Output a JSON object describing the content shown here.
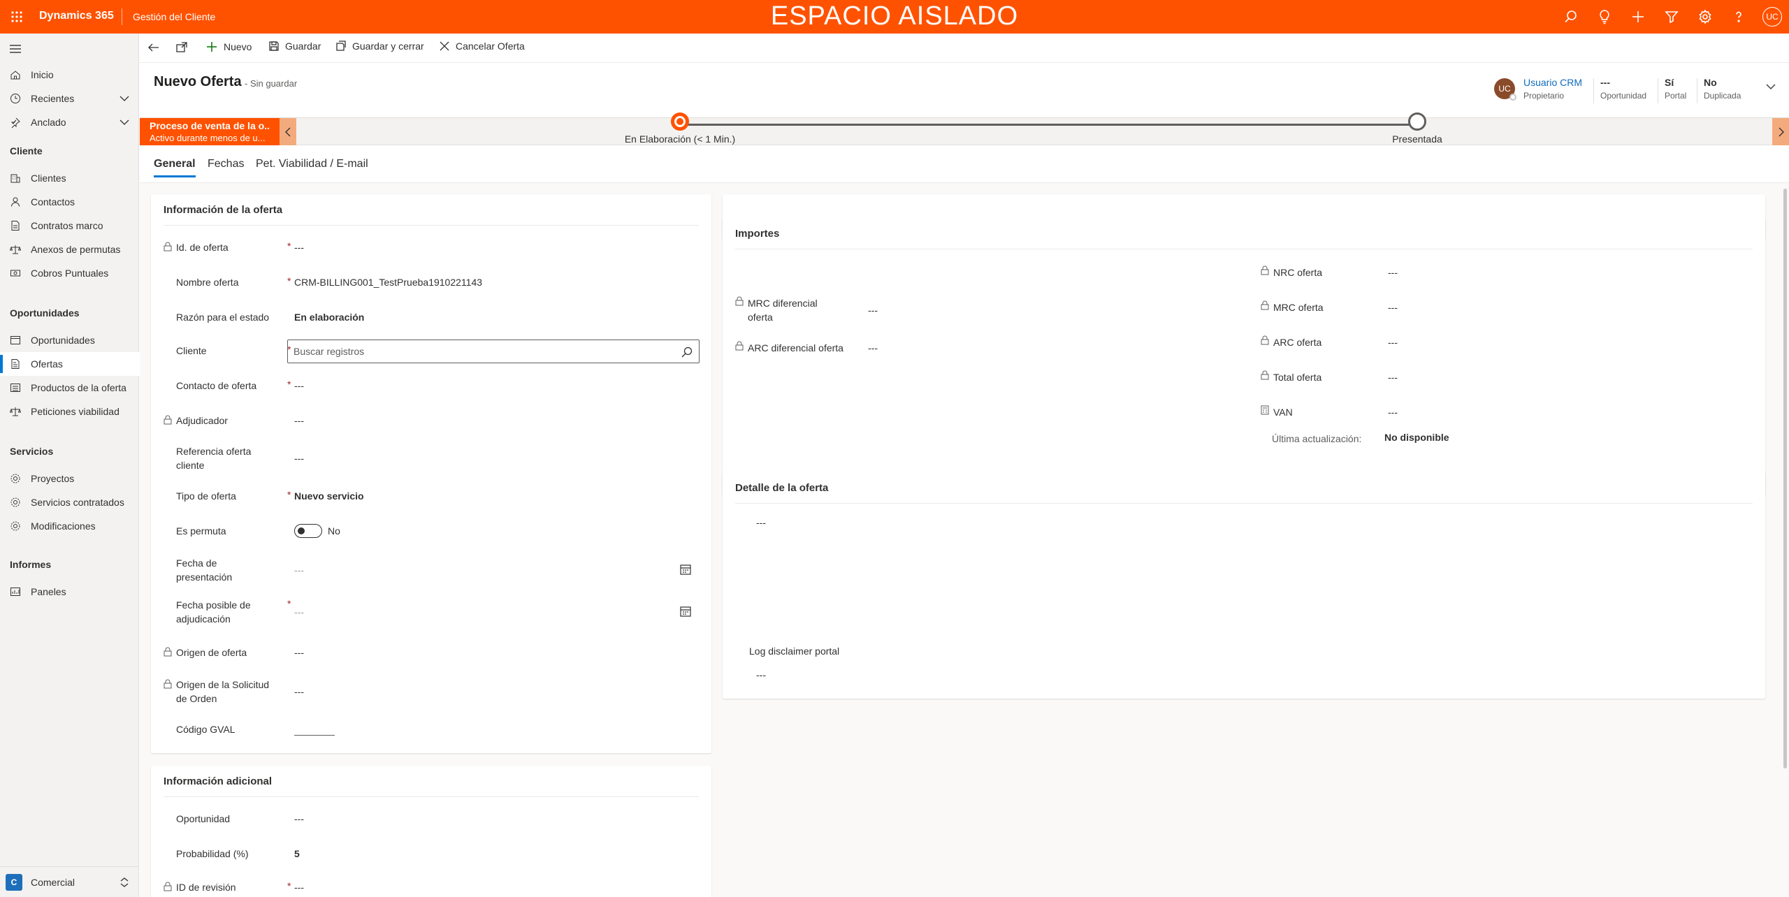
{
  "topbar": {
    "app_name": "Dynamics 365",
    "module": "Gestión del Cliente",
    "banner": "ESPACIO AISLADO",
    "user_initials": "UC",
    "icons": [
      "search-icon",
      "lightbulb-icon",
      "plus-icon",
      "filter-icon",
      "gear-icon",
      "help-icon"
    ]
  },
  "sidebar": {
    "top_items": [
      {
        "label": "Inicio",
        "icon": "home-icon"
      },
      {
        "label": "Recientes",
        "icon": "clock-icon"
      },
      {
        "label": "Anclado",
        "icon": "pin-icon"
      }
    ],
    "groups": [
      {
        "title": "Cliente",
        "items": [
          {
            "label": "Clientes",
            "icon": "building-icon"
          },
          {
            "label": "Contactos",
            "icon": "person-icon"
          },
          {
            "label": "Contratos marco",
            "icon": "document-icon"
          },
          {
            "label": "Anexos de permutas",
            "icon": "scale-icon"
          },
          {
            "label": "Cobros Puntuales",
            "icon": "money-icon"
          }
        ]
      },
      {
        "title": "Oportunidades",
        "items": [
          {
            "label": "Oportunidades",
            "icon": "window-icon"
          },
          {
            "label": "Ofertas",
            "icon": "quote-icon",
            "active": true
          },
          {
            "label": "Productos de la oferta",
            "icon": "list-icon"
          },
          {
            "label": "Peticiones viabilidad",
            "icon": "balance-icon"
          }
        ]
      },
      {
        "title": "Servicios",
        "items": [
          {
            "label": "Proyectos",
            "icon": "gear-icon"
          },
          {
            "label": "Servicios contratados",
            "icon": "gear-icon"
          },
          {
            "label": "Modificaciones",
            "icon": "gear-icon"
          }
        ]
      },
      {
        "title": "Informes",
        "items": [
          {
            "label": "Paneles",
            "icon": "dashboard-icon"
          }
        ]
      }
    ],
    "area": {
      "initial": "C",
      "label": "Comercial"
    }
  },
  "commands": {
    "new": "Nuevo",
    "save": "Guardar",
    "save_close": "Guardar y cerrar",
    "cancel": "Cancelar Oferta"
  },
  "header": {
    "title": "Nuevo Oferta",
    "subtitle": "- Sin guardar",
    "owner_initials": "UC",
    "owner_name": "Usuario CRM",
    "owner_label": "Propietario",
    "opportunity_value": "---",
    "opportunity_label": "Oportunidad",
    "portal_value": "Sí",
    "portal_label": "Portal",
    "duplicate_value": "No",
    "duplicate_label": "Duplicada"
  },
  "bpf": {
    "process_name": "Proceso de venta de la o...",
    "process_sub": "Activo durante menos de u...",
    "stage1": "En Elaboración  (< 1 Min.)",
    "stage2": "Presentada",
    "accent": "#ff5200"
  },
  "tabs": [
    "General",
    "Fechas",
    "Pet. Viabilidad / E-mail"
  ],
  "offer_info": {
    "title": "Información de la oferta",
    "fields": {
      "id_label": "Id. de oferta",
      "id_value": "---",
      "name_label": "Nombre oferta",
      "name_value": "CRM-BILLING001_TestPrueba1910221143",
      "status_label": "Razón para el estado",
      "status_value": "En elaboración",
      "client_label": "Cliente",
      "client_placeholder": "Buscar registros",
      "contact_label": "Contacto de oferta",
      "contact_value": "---",
      "awarder_label": "Adjudicador",
      "awarder_value": "---",
      "ref_label": "Referencia oferta cliente",
      "ref_value": "---",
      "type_label": "Tipo de oferta",
      "type_value": "Nuevo servicio",
      "swap_label": "Es permuta",
      "swap_value": "No",
      "present_date_label": "Fecha de presentación",
      "present_date_value": "---",
      "award_date_label": "Fecha posible de adjudicación",
      "award_date_value": "---",
      "origin_label": "Origen de oferta",
      "origin_value": "---",
      "order_origin_label": "Origen de la Solicitud de Orden",
      "order_origin_value": "---",
      "gval_label": "Código GVAL"
    },
    "required_mark": "*"
  },
  "additional_info": {
    "title": "Información adicional",
    "opportunity_label": "Oportunidad",
    "opportunity_value": "---",
    "probability_label": "Probabilidad (%)",
    "probability_value": "5",
    "revision_label": "ID de revisión",
    "revision_value": "---"
  },
  "amounts": {
    "title": "Importes",
    "mrc_diff_label": "MRC diferencial oferta",
    "mrc_diff_value": "---",
    "arc_diff_label": "ARC diferencial oferta",
    "arc_diff_value": "---",
    "nrc_label": "NRC oferta",
    "nrc_value": "---",
    "mrc_label": "MRC oferta",
    "mrc_value": "---",
    "arc_label": "ARC oferta",
    "arc_value": "---",
    "total_label": "Total oferta",
    "total_value": "---",
    "van_label": "VAN",
    "van_value": "---",
    "last_update_label": "Última actualización:",
    "last_update_value": "No disponible"
  },
  "detail": {
    "title": "Detalle de la oferta",
    "detail_value": "---",
    "disclaimer_label": "Log disclaimer portal",
    "disclaimer_value": "---"
  }
}
